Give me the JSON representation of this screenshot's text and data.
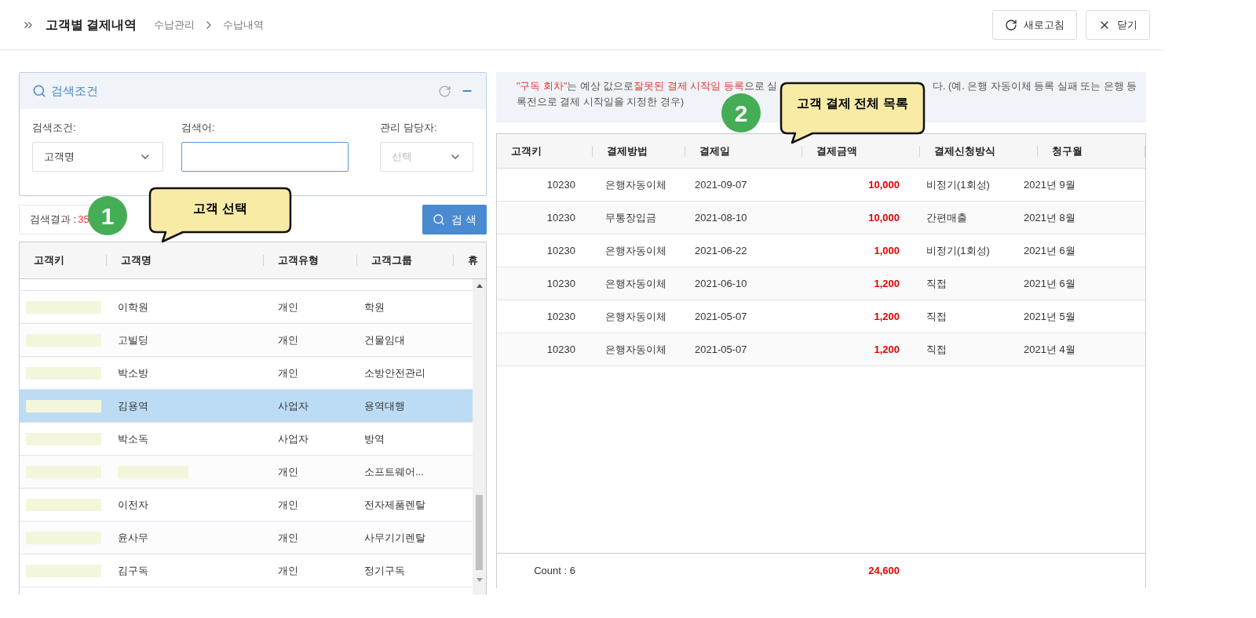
{
  "header": {
    "title": "고객별 결제내역",
    "breadcrumb": [
      "수납관리",
      "수납내역"
    ],
    "buttons": [
      {
        "label": "새로고침",
        "kind": "refresh"
      },
      {
        "label": "닫기",
        "kind": "close"
      }
    ]
  },
  "search_panel": {
    "title": "검색조건",
    "fields": [
      {
        "label": "검색조건:",
        "kind": "select",
        "value": "고객명"
      },
      {
        "label": "검색어:",
        "kind": "input"
      },
      {
        "label": "관리 담당자:",
        "kind": "select",
        "placeholder": "선택"
      }
    ]
  },
  "results": {
    "label": "검색결과 :",
    "count": "35",
    "search_button": "검 색"
  },
  "customer_table": {
    "columns": [
      "고객키",
      "고객명",
      "고객유형",
      "고객그룹",
      "휴"
    ],
    "rows": [
      {
        "name": "이학원",
        "name_redacted": false,
        "type": "개인",
        "group": "학원",
        "selected": false
      },
      {
        "name": "고빌딩",
        "name_redacted": false,
        "type": "개인",
        "group": "건물임대",
        "selected": false
      },
      {
        "name": "박소방",
        "name_redacted": false,
        "type": "개인",
        "group": "소방안전관리",
        "selected": false
      },
      {
        "name": "김용역",
        "name_redacted": false,
        "type": "사업자",
        "group": "용역대행",
        "selected": true
      },
      {
        "name": "박소독",
        "name_redacted": false,
        "type": "사업자",
        "group": "방역",
        "selected": false
      },
      {
        "name_redacted": true,
        "type": "개인",
        "group": "소프트웨어...",
        "selected": false
      },
      {
        "name": "이전자",
        "name_redacted": false,
        "type": "개인",
        "group": "전자제품렌탈",
        "selected": false
      },
      {
        "name": "윤사무",
        "name_redacted": false,
        "type": "개인",
        "group": "사무기기렌탈",
        "selected": false
      },
      {
        "name": "김구독",
        "name_redacted": false,
        "type": "개인",
        "group": "정기구독",
        "selected": false
      }
    ]
  },
  "callouts": [
    {
      "number": "1",
      "text": "고객 선택"
    },
    {
      "number": "2",
      "text": "고객 결제 전체 목록"
    }
  ],
  "notice": {
    "segments": [
      {
        "text": "\"구독 회차\"",
        "highlight": true
      },
      {
        "text": "는 예상 값으로 ",
        "highlight": false
      },
      {
        "text": "잘못된 결제 시작일 등록",
        "highlight": true
      },
      {
        "text": "으로 실",
        "highlight": false
      }
    ],
    "continuation": [
      "다. (예. 은행 자동이체 등록 실패 또는 은행 등",
      "록전으로 결제 시작일을 지정한 경우)"
    ]
  },
  "payment_table": {
    "columns": [
      "고객키",
      "결제방법",
      "결제일",
      "결제금액",
      "결제신청방식",
      "청구월"
    ],
    "rows": [
      {
        "key": "10230",
        "method": "은행자동이체",
        "date": "2021-09-07",
        "amount": "10,000",
        "request": "비정기(1회성)",
        "month": "2021년 9월"
      },
      {
        "key": "10230",
        "method": "무통장입금",
        "date": "2021-08-10",
        "amount": "10,000",
        "request": "간편매출",
        "month": "2021년 8월"
      },
      {
        "key": "10230",
        "method": "은행자동이체",
        "date": "2021-06-22",
        "amount": "1,000",
        "request": "비정기(1회성)",
        "month": "2021년 6월"
      },
      {
        "key": "10230",
        "method": "은행자동이체",
        "date": "2021-06-10",
        "amount": "1,200",
        "request": "직접",
        "month": "2021년 6월"
      },
      {
        "key": "10230",
        "method": "은행자동이체",
        "date": "2021-05-07",
        "amount": "1,200",
        "request": "직접",
        "month": "2021년 5월"
      },
      {
        "key": "10230",
        "method": "은행자동이체",
        "date": "2021-05-07",
        "amount": "1,200",
        "request": "직접",
        "month": "2021년 4월"
      }
    ],
    "footer": {
      "count": "Count : 6",
      "total": "24,600"
    }
  }
}
